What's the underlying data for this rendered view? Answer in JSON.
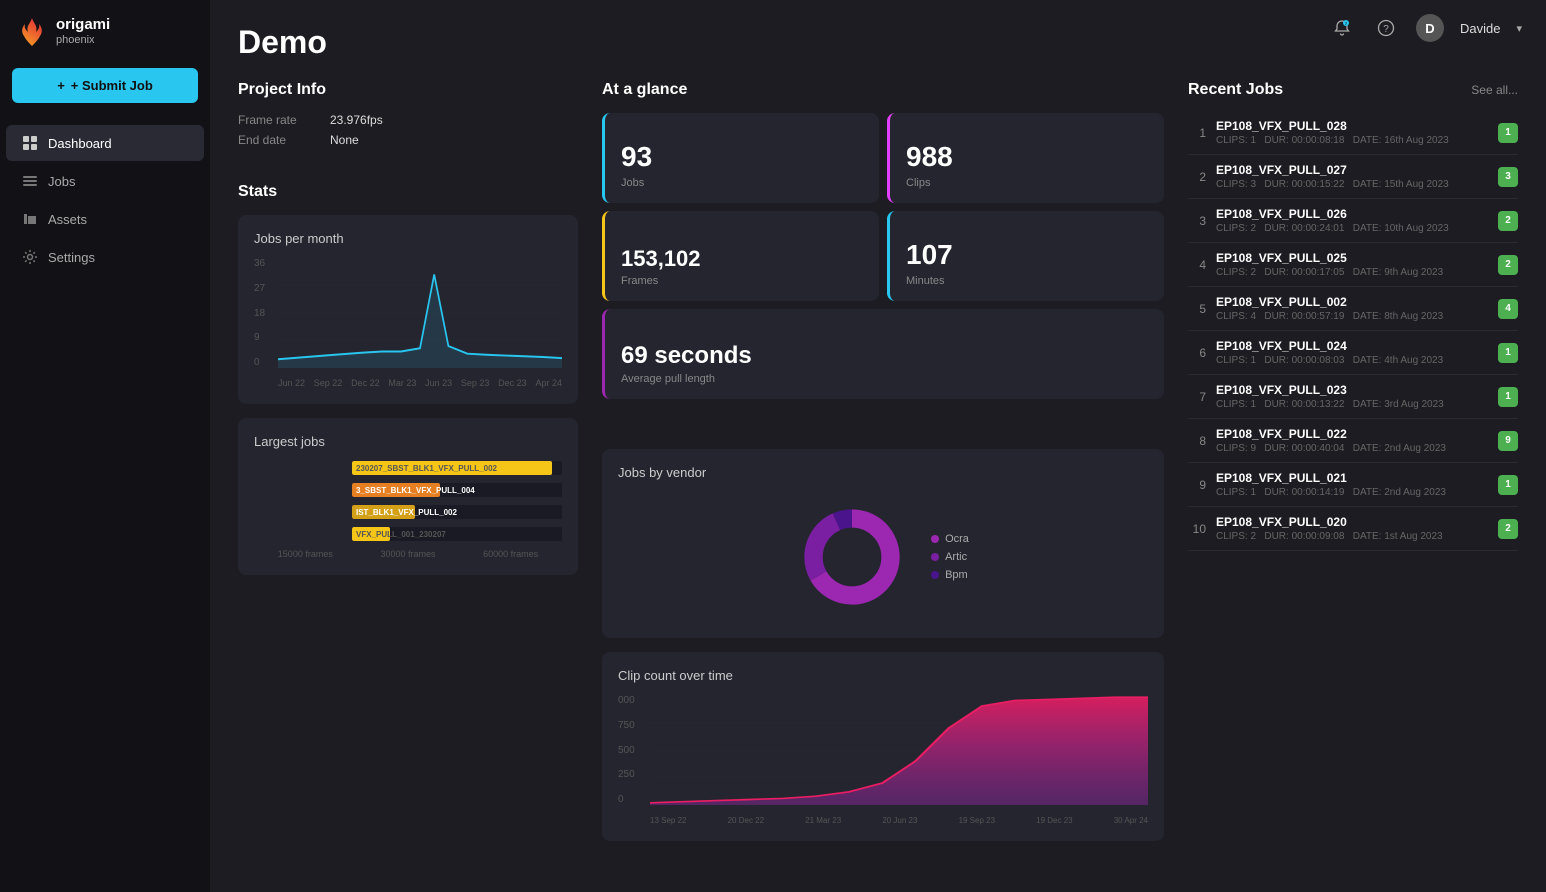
{
  "app": {
    "name": "origami",
    "subtitle": "phoenix"
  },
  "sidebar": {
    "submit_label": "+ Submit Job",
    "nav_items": [
      {
        "id": "dashboard",
        "label": "Dashboard",
        "active": true
      },
      {
        "id": "jobs",
        "label": "Jobs",
        "active": false
      },
      {
        "id": "assets",
        "label": "Assets",
        "active": false
      },
      {
        "id": "settings",
        "label": "Settings",
        "active": false
      }
    ]
  },
  "topbar": {
    "user_initial": "D",
    "user_name": "Davide"
  },
  "page": {
    "title": "Demo"
  },
  "project_info": {
    "section_title": "Project Info",
    "frame_rate_label": "Frame rate",
    "frame_rate_value": "23.976fps",
    "end_date_label": "End date",
    "end_date_value": "None"
  },
  "at_a_glance": {
    "section_title": "At a glance",
    "cards": [
      {
        "number": "93",
        "label": "Jobs",
        "color": "blue"
      },
      {
        "number": "988",
        "label": "Clips",
        "color": "pink"
      },
      {
        "number": "153,102",
        "label": "Frames",
        "color": "yellow"
      },
      {
        "number": "107",
        "label": "Minutes",
        "color": "blue"
      },
      {
        "number": "69 seconds",
        "label": "Average pull length",
        "color": "purple"
      }
    ]
  },
  "recent_jobs": {
    "section_title": "Recent Jobs",
    "see_all_label": "See all...",
    "items": [
      {
        "num": "1",
        "name": "EP108_VFX_PULL_028",
        "clips": "1",
        "dur": "00:00:08:18",
        "date": "16th Aug 2023",
        "badge": "1"
      },
      {
        "num": "2",
        "name": "EP108_VFX_PULL_027",
        "clips": "3",
        "dur": "00:00:15:22",
        "date": "15th Aug 2023",
        "badge": "3"
      },
      {
        "num": "3",
        "name": "EP108_VFX_PULL_026",
        "clips": "2",
        "dur": "00:00:24:01",
        "date": "10th Aug 2023",
        "badge": "2"
      },
      {
        "num": "4",
        "name": "EP108_VFX_PULL_025",
        "clips": "2",
        "dur": "00:00:17:05",
        "date": "9th Aug 2023",
        "badge": "2"
      },
      {
        "num": "5",
        "name": "EP108_VFX_PULL_002",
        "clips": "4",
        "dur": "00:00:57:19",
        "date": "8th Aug 2023",
        "badge": "4"
      },
      {
        "num": "6",
        "name": "EP108_VFX_PULL_024",
        "clips": "1",
        "dur": "00:00:08:03",
        "date": "4th Aug 2023",
        "badge": "1"
      },
      {
        "num": "7",
        "name": "EP108_VFX_PULL_023",
        "clips": "1",
        "dur": "00:00:13:22",
        "date": "3rd Aug 2023",
        "badge": "1"
      },
      {
        "num": "8",
        "name": "EP108_VFX_PULL_022",
        "clips": "9",
        "dur": "00:00:40:04",
        "date": "2nd Aug 2023",
        "badge": "9"
      },
      {
        "num": "9",
        "name": "EP108_VFX_PULL_021",
        "clips": "1",
        "dur": "00:00:14:19",
        "date": "2nd Aug 2023",
        "badge": "1"
      },
      {
        "num": "10",
        "name": "EP108_VFX_PULL_020",
        "clips": "2",
        "dur": "00:00:09:08",
        "date": "1st Aug 2023",
        "badge": "2"
      }
    ]
  },
  "stats": {
    "section_title": "Stats",
    "jobs_per_month": {
      "title": "Jobs per month",
      "y_labels": [
        "36",
        "27",
        "18",
        "9",
        "0"
      ],
      "x_labels": [
        "Jun 22",
        "Sep 22",
        "Dec 22",
        "Mar 23",
        "Jun 23",
        "Sep 23",
        "Dec 23",
        "Apr 24"
      ]
    },
    "jobs_by_vendor": {
      "title": "Jobs by vendor",
      "legend": [
        {
          "label": "Ocra",
          "color": "#9c27b0"
        },
        {
          "label": "Artic",
          "color": "#7b1fa2"
        },
        {
          "label": "Bpm",
          "color": "#4a148c"
        }
      ]
    },
    "largest_jobs": {
      "title": "Largest jobs",
      "bars": [
        {
          "label": "230207_SBST_BLK1_VFX_PULL_002",
          "pct": 95,
          "color": "yellow",
          "short": "230207_SBST_BLK1_VFX_PULL_002"
        },
        {
          "label": "3_SBST_BLK1_VFX_PULL_004",
          "pct": 42,
          "color": "orange",
          "short": "3_SBST_BLK1_VFX_PULL_004"
        },
        {
          "label": "IST_BLK1_VFX_PULL_002",
          "pct": 30,
          "color": "gold",
          "short": "IST_BLK1_VFX_PULL_002"
        },
        {
          "label": "VFX_PULL_001_230207",
          "pct": 18,
          "color": "yellow",
          "short": "VFX_PULL_001_230207"
        }
      ],
      "x_labels": [
        "15000 frames",
        "30000 frames",
        "60000 frames"
      ]
    },
    "clip_count": {
      "title": "Clip count over time",
      "y_labels": [
        "000",
        "750",
        "500",
        "250",
        "0"
      ],
      "x_labels": [
        "13 Sep 22",
        "20 Dec 22",
        "21 Mar 23",
        "20 Jun 23",
        "19 Sep 23",
        "19 Dec 23",
        "30 Apr 24"
      ]
    }
  },
  "colors": {
    "accent": "#29c6ef",
    "sidebar_bg": "#111116",
    "card_bg": "#252530",
    "active_nav": "#2a2a35"
  }
}
